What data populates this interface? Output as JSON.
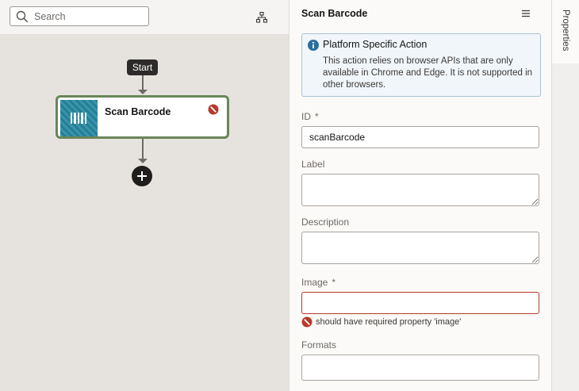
{
  "canvas": {
    "search": {
      "placeholder": "Search",
      "value": ""
    },
    "start_label": "Start",
    "action": {
      "title": "Scan Barcode",
      "has_error": true
    }
  },
  "properties": {
    "title": "Scan Barcode",
    "info": {
      "title": "Platform Specific Action",
      "text": "This action relies on browser APIs that are only available in Chrome and Edge. It is not supported in other browsers."
    },
    "fields": {
      "id": {
        "label": "ID",
        "required_mark": "*",
        "value": "scanBarcode"
      },
      "label": {
        "label": "Label",
        "value": ""
      },
      "description": {
        "label": "Description",
        "value": ""
      },
      "image": {
        "label": "Image",
        "required_mark": "*",
        "value": "",
        "error": "should have required property 'image'"
      },
      "formats": {
        "label": "Formats",
        "value": ""
      }
    }
  },
  "side_tabs": {
    "properties": "Properties"
  },
  "colors": {
    "error": "#b73a2e",
    "node_border": "#6a8658",
    "info_accent": "#2a6f9e",
    "thumbnail": "#25879f"
  }
}
